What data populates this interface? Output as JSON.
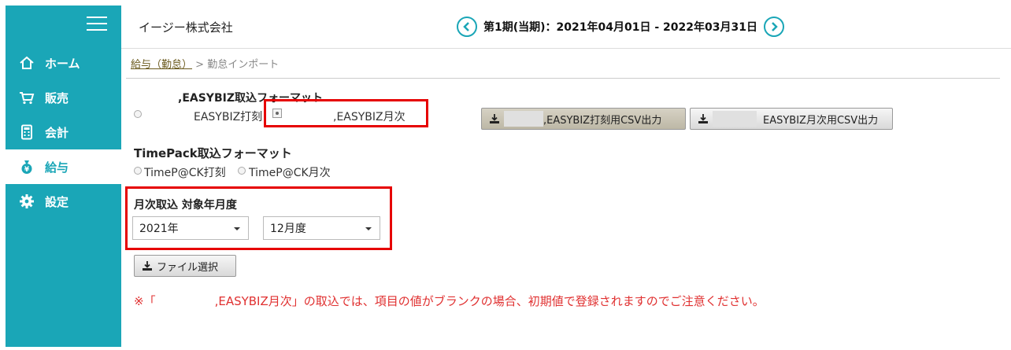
{
  "app": {
    "company": "イージー株式会社"
  },
  "period": {
    "text": "第1期(当期)：2021年04月01日 - 2022年03月31日"
  },
  "sidebar": {
    "items": [
      {
        "label": "ホーム",
        "icon": "home-icon"
      },
      {
        "label": "販売",
        "icon": "cart-icon"
      },
      {
        "label": "会計",
        "icon": "calculator-icon"
      },
      {
        "label": "給与",
        "icon": "money-bag-icon",
        "active": true
      },
      {
        "label": "設定",
        "icon": "gear-icon"
      }
    ]
  },
  "breadcrumb": {
    "parent": "給与（勤怠）",
    "separator": ">",
    "current": "勤怠インポート"
  },
  "easybiz": {
    "heading": ",EASYBIZ取込フォーマット",
    "option1": "EASYBIZ打刻",
    "option2": ",EASYBIZ月次",
    "export_punch": ",EASYBIZ打刻用CSV出力",
    "export_monthly": "EASYBIZ月次用CSV出力"
  },
  "timepack": {
    "heading": "TimePack取込フォーマット",
    "option1": "TimeP@CK打刻",
    "option2": "TimeP@CK月次"
  },
  "monthly": {
    "heading": "月次取込 対象年月度",
    "year": "2021年",
    "month": "12月度"
  },
  "file_button": "ファイル選択",
  "notice": "※「　　　　　,EASYBIZ月次」の取込では、項目の値がブランクの場合、初期値で登録されますのでご注意ください。",
  "colors": {
    "accent": "#1aa6b7",
    "highlight": "#e60000",
    "notice": "#e03030"
  }
}
